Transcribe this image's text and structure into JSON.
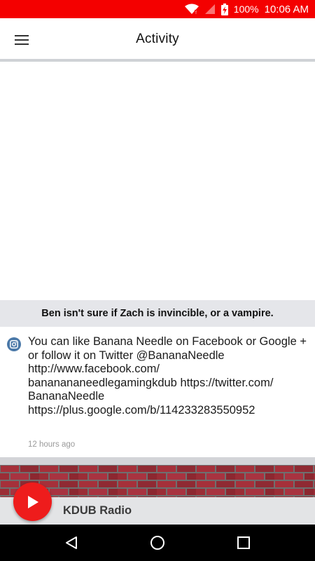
{
  "status_bar": {
    "battery": "100%",
    "time": "10:06 AM",
    "icons": [
      "wifi-icon",
      "signal-icon",
      "battery-charging-icon"
    ],
    "background": "#f40000"
  },
  "app_bar": {
    "title": "Activity",
    "menu_icon": "hamburger-menu-icon"
  },
  "post": {
    "title": "Ben isn't sure if Zach is invincible, or a vampire.",
    "source_icon": "instagram-icon",
    "text": "You can like Banana Needle on Facebook or Google + or follow it on Twitter @BananaNeedle\nhttp://www.facebook.com/\nbananananeedlegamingkdub https://twitter.com/\nBananaNeedle\nhttps://plus.google.com/b/114233283550952",
    "time": "12 hours ago"
  },
  "player": {
    "station": "KDUB Radio",
    "play_icon": "play-icon",
    "accent": "#ee1c1c",
    "artwork": "brick-wall-artwork"
  },
  "nav": {
    "buttons": [
      "back-icon",
      "home-icon",
      "recents-icon"
    ]
  }
}
